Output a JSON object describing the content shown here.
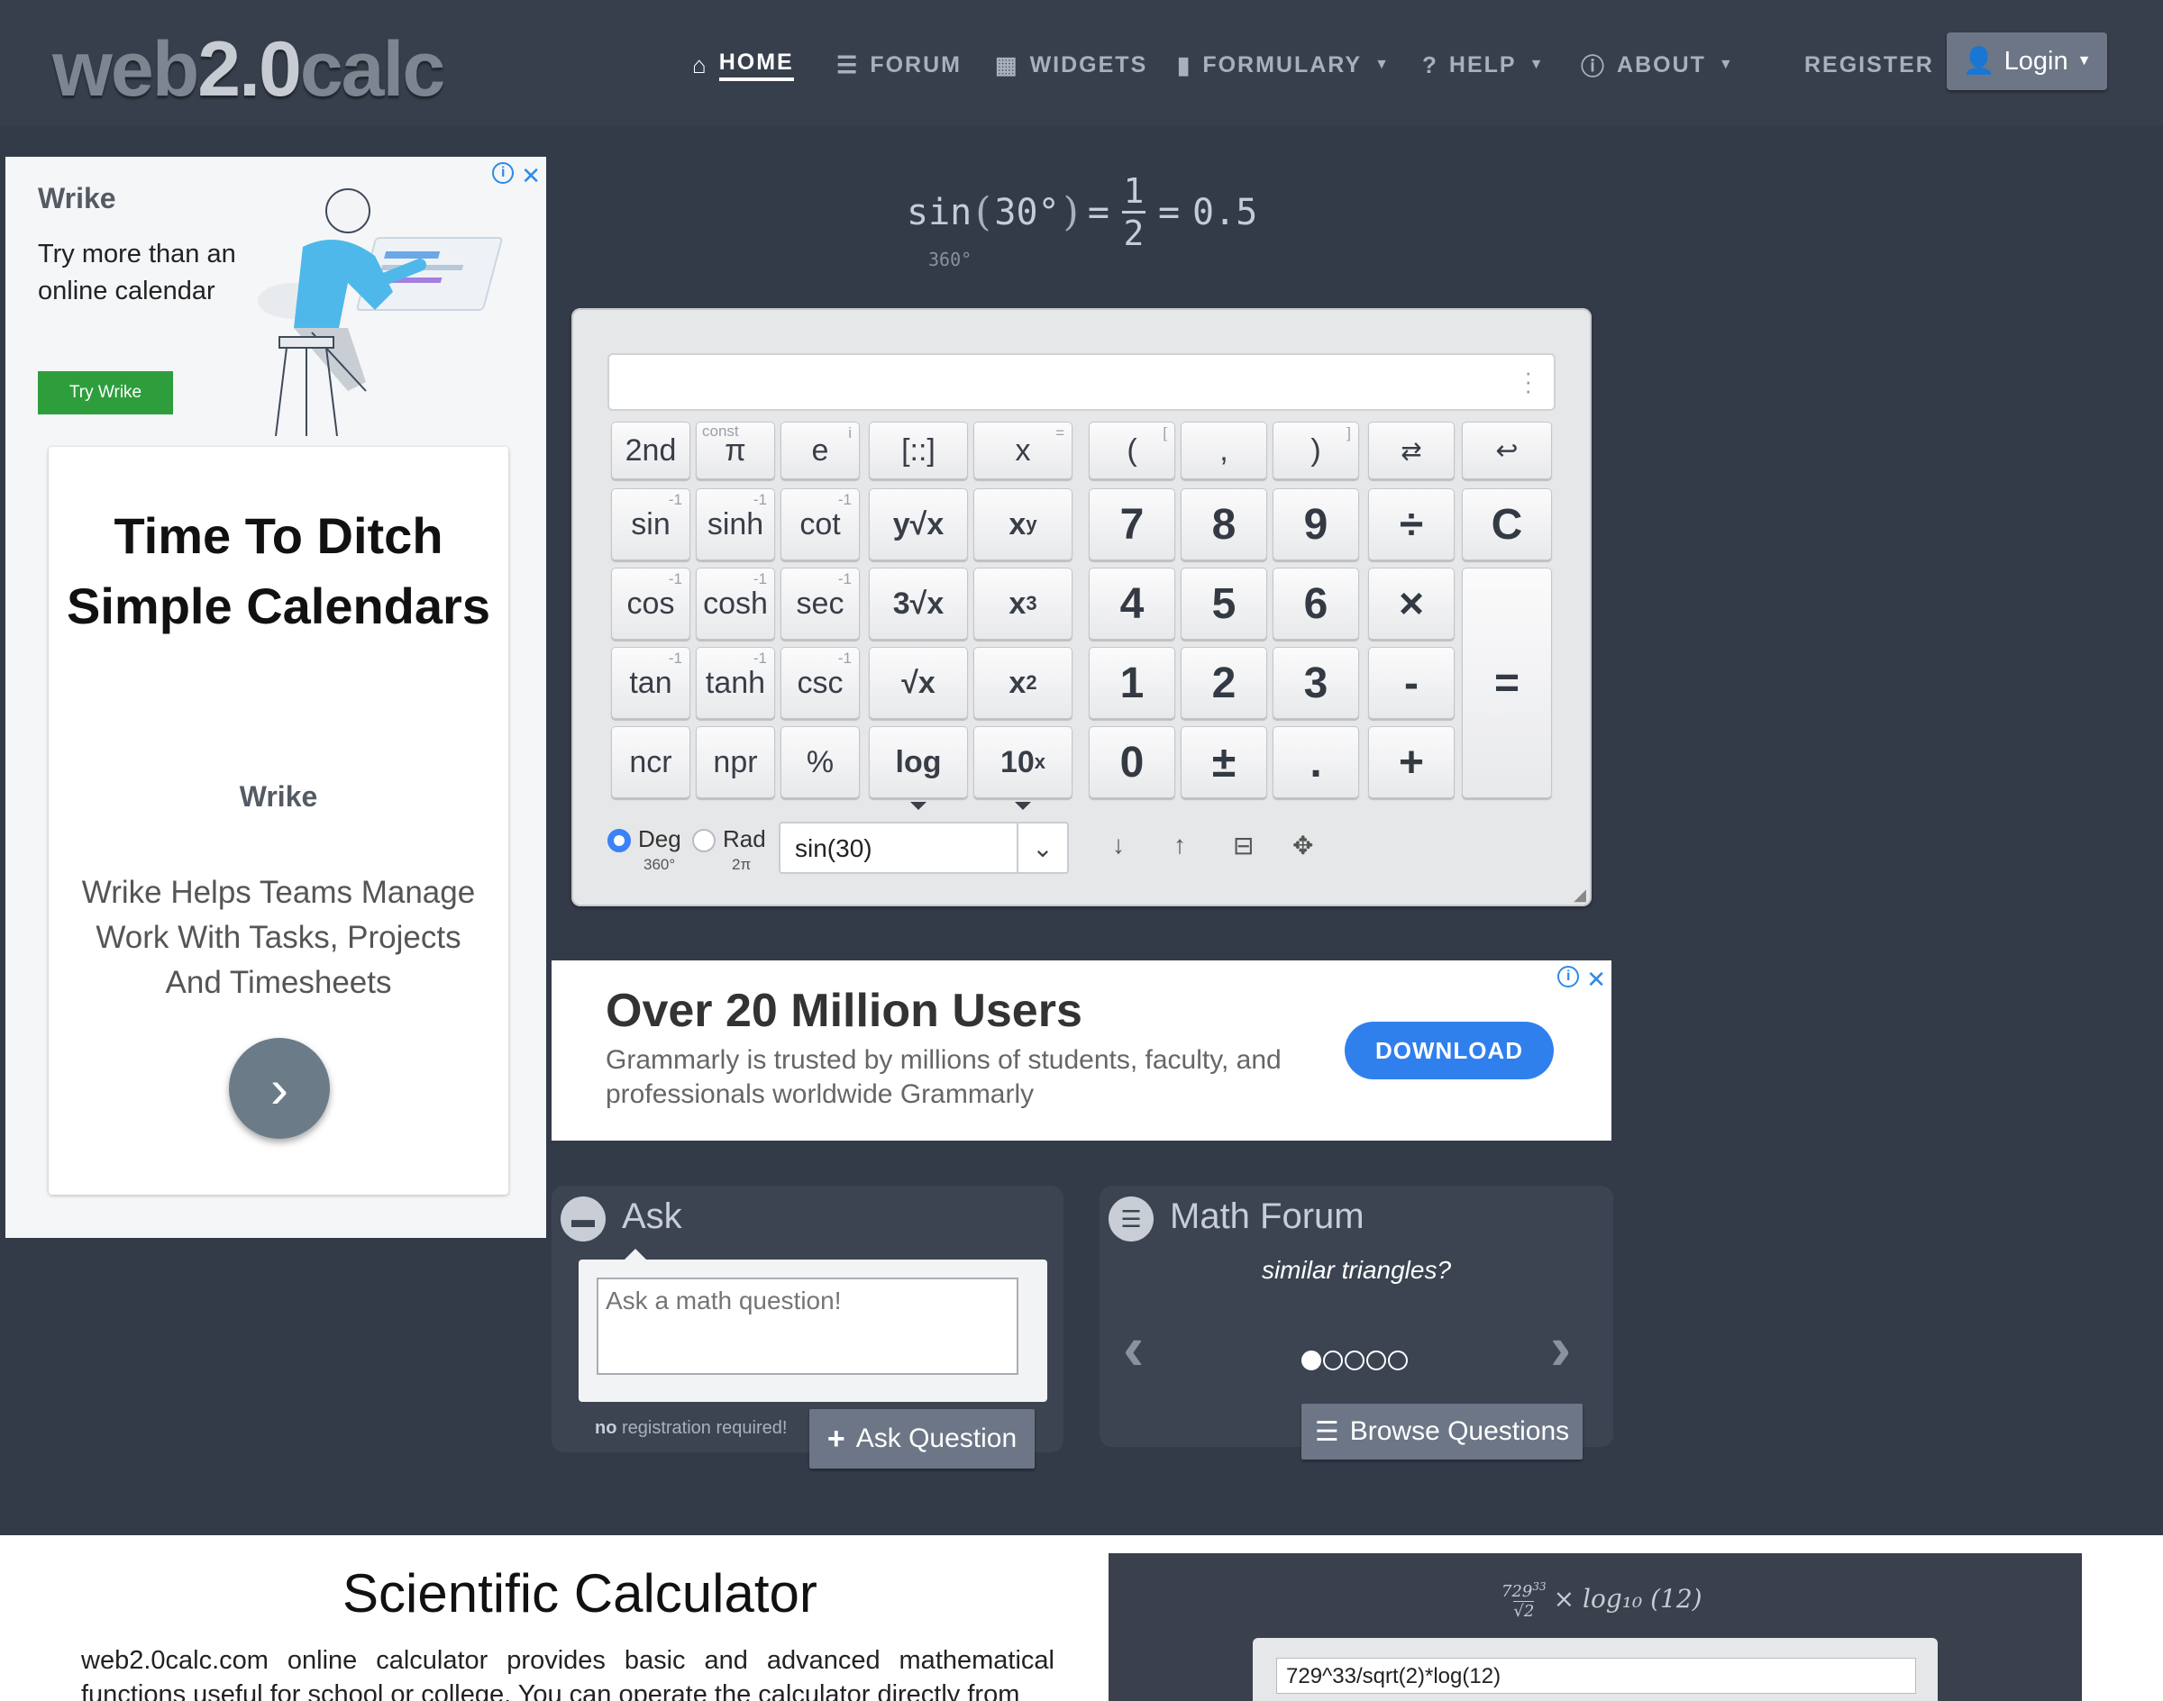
{
  "logo": {
    "prefix": "web",
    "bold": "2.0",
    "suffix": "calc"
  },
  "nav": {
    "home": "HOME",
    "forum": "FORUM",
    "widgets": "WIDGETS",
    "formulary": "FORMULARY",
    "help": "HELP",
    "about": "ABOUT",
    "register": "REGISTER",
    "login": "Login"
  },
  "left_ad": {
    "brand": "Wrike",
    "tagline": "Try more than an online calendar",
    "cta": "Try Wrike",
    "headline": "Time To Ditch Simple Calendars",
    "description": "Wrike Helps Teams Manage Work With Tasks, Projects And Timesheets",
    "adchoice_icon": "info-icon",
    "close_icon": "close-icon"
  },
  "formula": {
    "func": "sin",
    "arg": "30°",
    "numerator": "1",
    "denominator": "2",
    "result": "0.5",
    "unit_note": "360°"
  },
  "calculator": {
    "display_value": "",
    "keys": {
      "second": "2nd",
      "pi": "π",
      "pi_sup": "const",
      "e": "e",
      "e_sup": "i",
      "matrix": "[::]",
      "x": "x",
      "x_sup": "=",
      "lparen": "(",
      "lparen_sup": "[",
      "comma": ",",
      "rparen": ")",
      "rparen_sup": "]",
      "sin": "sin",
      "sinh": "sinh",
      "cot": "cot",
      "yroot": "y√x",
      "xpow": "x",
      "xpow_sup": "y",
      "cos": "cos",
      "cosh": "cosh",
      "sec": "sec",
      "cbrt": "3√x",
      "cube": "x",
      "cube_sup": "3",
      "tan": "tan",
      "tanh": "tanh",
      "csc": "csc",
      "sqrt": "√x",
      "square": "x",
      "square_sup": "2",
      "ncr": "ncr",
      "npr": "npr",
      "percent": "%",
      "log": "log",
      "tenpow": "10",
      "tenpow_sup": "x",
      "inverse_sup": "-1",
      "d7": "7",
      "d8": "8",
      "d9": "9",
      "divide": "÷",
      "clear": "C",
      "d4": "4",
      "d5": "5",
      "d6": "6",
      "multiply": "×",
      "d1": "1",
      "d2": "2",
      "d3": "3",
      "minus": "-",
      "equals": "=",
      "d0": "0",
      "plusminus": "±",
      "dot": ".",
      "plus": "+"
    },
    "mode": {
      "deg": "Deg",
      "deg_sub": "360°",
      "rad": "Rad",
      "rad_sub": "2π",
      "selected": "Deg"
    },
    "history_value": "sin(30)"
  },
  "grammarly_ad": {
    "title": "Over 20 Million Users",
    "text": "Grammarly is trusted by millions of students, faculty, and professionals worldwide Grammarly",
    "button": "DOWNLOAD"
  },
  "ask": {
    "title": "Ask",
    "placeholder": "Ask a math question!",
    "note_bold": "no",
    "note_rest": " registration required!",
    "button": "Ask Question"
  },
  "forum": {
    "title": "Math Forum",
    "question": "similar triangles?",
    "page_count": 5,
    "current_page": 1,
    "button": "Browse Questions"
  },
  "info": {
    "title": "Scientific Calculator",
    "text": "web2.0calc.com online calculator provides basic and advanced mathematical functions useful for school or college. You can operate the calculator directly from"
  },
  "thumbnail": {
    "formula": "× log₁₀ (12)",
    "input": "729^33/sqrt(2)*log(12)"
  }
}
